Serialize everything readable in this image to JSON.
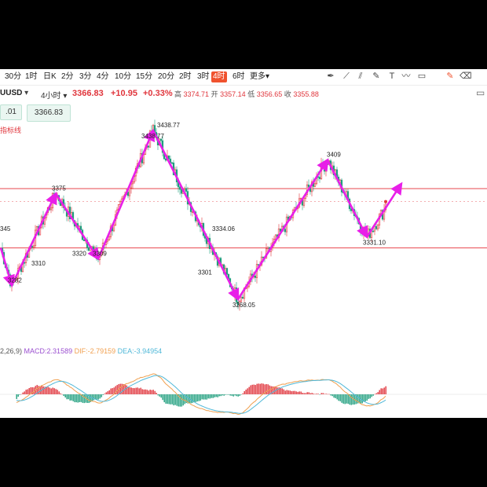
{
  "toolbar": {
    "timeframes": [
      "30分",
      "1时",
      "日K",
      "2分",
      "3分",
      "4分",
      "10分",
      "15分",
      "20分",
      "2时",
      "3时",
      "4时",
      "6时",
      "更多▾"
    ],
    "active": "4时",
    "tool_icons": [
      "pen-icon",
      "line-tool-icon",
      "channel-tool-icon",
      "pencil-icon",
      "text-tool-icon",
      "curve-tool-icon",
      "rectangle-tool-icon",
      "edit-icon",
      "eraser-icon"
    ]
  },
  "quote": {
    "symbol": "UUSD",
    "period": "4小时",
    "price": "3366.83",
    "change": "+10.95",
    "change_pct": "+0.33%",
    "high_label": "高",
    "high": "3374.71",
    "open_label": "开",
    "open": "3357.14",
    "low_label": "低",
    "low": "3356.65",
    "close_label": "收",
    "close": "3355.88"
  },
  "boxes": {
    "left_value": ".01",
    "right_value": "3366.83",
    "indicator_label": "指标线"
  },
  "macd": {
    "params": "2,26,9)",
    "macd_label": "MACD:2.31589",
    "dif_label": "DIF:-2.79159",
    "dea_label": "DEA:-3.94954"
  },
  "colors": {
    "up": "#e0353c",
    "down": "#1f9e7e",
    "arrow": "#e81fe8",
    "hline": "#e8474e",
    "dif": "#f0a050",
    "dea": "#50b8d8"
  },
  "chart_data": {
    "type": "candlestick",
    "axis": {
      "ylim": [
        3245,
        3450
      ],
      "horizontal_lines": [
        3380,
        3320
      ],
      "dashed_line": 3366.83
    },
    "annotations": [
      {
        "idx": 2,
        "price": 3345,
        "text": "345"
      },
      {
        "idx": 7,
        "price": 3282,
        "text": "3282"
      },
      {
        "idx": 22,
        "price": 3310,
        "text": "3310"
      },
      {
        "idx": 35,
        "price": 3375,
        "text": "3375"
      },
      {
        "idx": 48,
        "price": 3320,
        "text": "3320"
      },
      {
        "idx": 61,
        "price": 3309,
        "text": "3309"
      },
      {
        "idx": 92,
        "price": 3438.77,
        "text": "3438.77"
      },
      {
        "idx": 102,
        "price": 3438.77,
        "text": "3438.77"
      },
      {
        "idx": 128,
        "price": 3301,
        "text": "3301"
      },
      {
        "idx": 137,
        "price": 3334.06,
        "text": "3334.06"
      },
      {
        "idx": 150,
        "price": 3268.05,
        "text": "3268.05"
      },
      {
        "idx": 210,
        "price": 3409,
        "text": "3409"
      },
      {
        "idx": 233,
        "price": 3331.1,
        "text": "3331.10"
      }
    ],
    "pivots": [
      {
        "idx": 0,
        "price": 3320
      },
      {
        "idx": 7,
        "price": 3282
      },
      {
        "idx": 35,
        "price": 3375
      },
      {
        "idx": 62,
        "price": 3309
      },
      {
        "idx": 97,
        "price": 3438.77
      },
      {
        "idx": 151,
        "price": 3268.05
      },
      {
        "idx": 208,
        "price": 3409
      },
      {
        "idx": 233,
        "price": 3331.1
      },
      {
        "idx": 255,
        "price": 3385
      }
    ],
    "last_price": 3366.83,
    "note": "OHLC candles are generated between pivots; MACD histogram derived from price"
  }
}
